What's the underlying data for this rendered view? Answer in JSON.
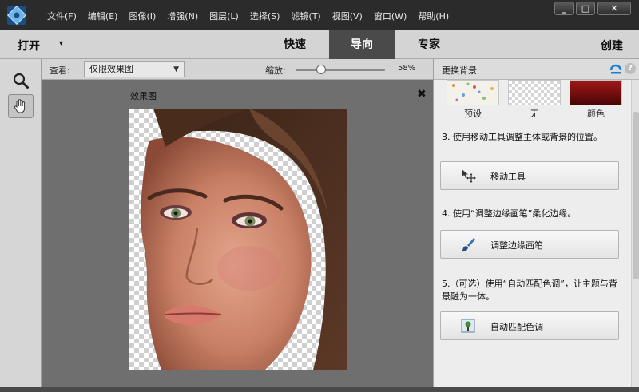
{
  "menubar": {
    "items": [
      "文件(F)",
      "编辑(E)",
      "图像(I)",
      "增强(N)",
      "图层(L)",
      "选择(S)",
      "滤镜(T)",
      "视图(V)",
      "窗口(W)",
      "帮助(H)"
    ],
    "window_buttons": {
      "minimize": "_",
      "maximize": "□",
      "close": "✕"
    }
  },
  "modebar": {
    "open_label": "打开",
    "open_caret": "▾",
    "tabs": [
      "快速",
      "导向",
      "专家"
    ],
    "active_tab": "导向",
    "create_label": "创建"
  },
  "toolbar": {
    "tools": [
      {
        "name": "zoom-tool",
        "icon": "magnifier-icon",
        "selected": false
      },
      {
        "name": "hand-tool",
        "icon": "hand-icon",
        "selected": true
      }
    ]
  },
  "options": {
    "view_label": "查看:",
    "view_value": "仅限效果图",
    "zoom_label": "缩放:",
    "zoom_value": "58%",
    "zoom_fraction": 0.26
  },
  "document": {
    "title": "效果图",
    "close_glyph": "✖"
  },
  "panel": {
    "title": "更换背景",
    "help_glyph": "?",
    "backgrounds": [
      {
        "label": "预设",
        "swatch": "confetti"
      },
      {
        "label": "无",
        "swatch": "transparent"
      },
      {
        "label": "颜色",
        "swatch": "#7a0a0a"
      }
    ],
    "step3": "3. 使用移动工具调整主体或背景的位置。",
    "move_button": "移动工具",
    "step4": "4. 使用“调整边缘画笔”柔化边缘。",
    "brush_button": "调整边缘画笔",
    "step5": "5.（可选）使用“自动匹配色调”，让主题与背景融为一体。",
    "match_button": "自动匹配色调"
  },
  "colors": {
    "accent_blue": "#1a7fd1",
    "titlebar": "#2b2b2b",
    "active_tab": "#4a4a4a"
  }
}
